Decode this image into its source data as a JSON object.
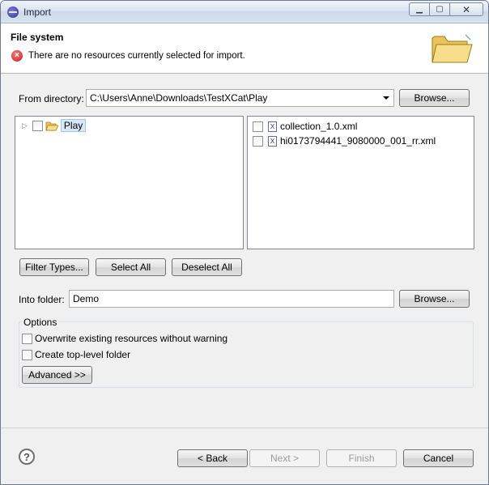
{
  "window": {
    "title": "Import",
    "colors": {
      "titlebar": "#dbe5f1",
      "dialog_bg": "#f0f0f0",
      "error": "#c81e1e"
    }
  },
  "banner": {
    "title": "File system",
    "message": "There are no resources currently selected for import."
  },
  "source": {
    "from_label": "From directory:",
    "from_value": "C:\\Users\\Anne\\Downloads\\TestXCat\\Play",
    "browse_label": "Browse..."
  },
  "tree": {
    "items": [
      {
        "label": "Play"
      }
    ]
  },
  "files": {
    "items": [
      {
        "label": "collection_1.0.xml"
      },
      {
        "label": "hi0173794441_9080000_001_rr.xml"
      }
    ]
  },
  "selection_buttons": {
    "filter": "Filter Types...",
    "select_all": "Select All",
    "deselect_all": "Deselect All"
  },
  "destination": {
    "into_label": "Into folder:",
    "into_value": "Demo",
    "browse_label": "Browse..."
  },
  "options": {
    "title": "Options",
    "overwrite": "Overwrite existing resources without warning",
    "top_level": "Create top-level folder",
    "advanced": "Advanced >>"
  },
  "footer": {
    "back": "< Back",
    "next": "Next >",
    "finish": "Finish",
    "cancel": "Cancel"
  }
}
